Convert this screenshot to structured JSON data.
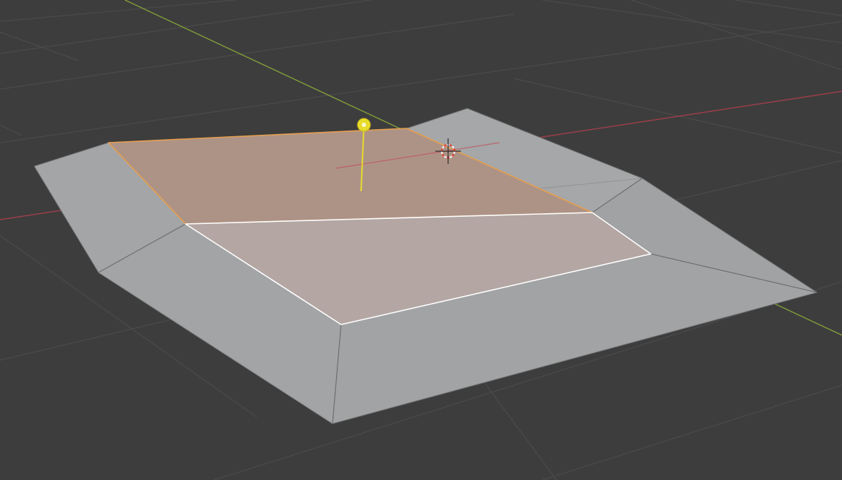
{
  "viewport": {
    "mode": "edit-mode",
    "selection": "faces",
    "selected_face_count": 2,
    "gizmo": "normal-direction-arrow",
    "colors": {
      "background": "#3d3d3d",
      "grid_line": "#4d4d4d",
      "x_axis": "#9b3f4a",
      "y_axis": "#7f9a3a",
      "mesh_face": "#a3a5a6",
      "mesh_face_dark": "#9a9c9d",
      "mesh_edge": "#6f7172",
      "selected_face": "#ad9386",
      "selected_face_inner": "#b3a6a3",
      "active_outline": "#ffffff",
      "selected_edge": "#e79f4f",
      "normal_arrow": "#e8dc2a",
      "cursor_ring_red": "#e0463a",
      "cursor_ring_white": "#f2f2f2"
    },
    "icons": [
      "3d-cursor-icon",
      "normal-gizmo-icon"
    ]
  }
}
